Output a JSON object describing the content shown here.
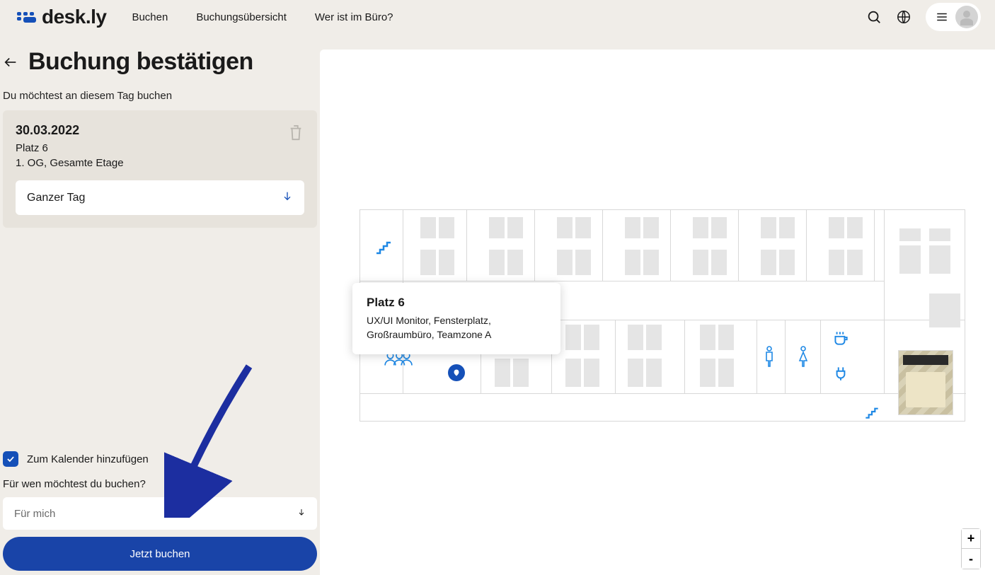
{
  "brand": "desk.ly",
  "nav": {
    "items": [
      {
        "label": "Buchen"
      },
      {
        "label": "Buchungsübersicht"
      },
      {
        "label": "Wer ist im Büro?"
      }
    ]
  },
  "page": {
    "title": "Buchung bestätigen",
    "subtitle": "Du möchtest an diesem Tag buchen"
  },
  "booking": {
    "date": "30.03.2022",
    "place": "Platz 6",
    "floor": "1. OG, Gesamte Etage",
    "duration_selected": "Ganzer Tag"
  },
  "calendar_checkbox": {
    "checked": true,
    "label": "Zum Kalender hinzufügen"
  },
  "for_whom": {
    "label": "Für wen möchtest du buchen?",
    "selected": "Für mich"
  },
  "cta": {
    "label": "Jetzt buchen"
  },
  "tooltip": {
    "title": "Platz 6",
    "desc": "UX/UI Monitor, Fensterplatz, Großraumbüro, Teamzone A"
  },
  "zoom": {
    "in": "+",
    "out": "-"
  }
}
